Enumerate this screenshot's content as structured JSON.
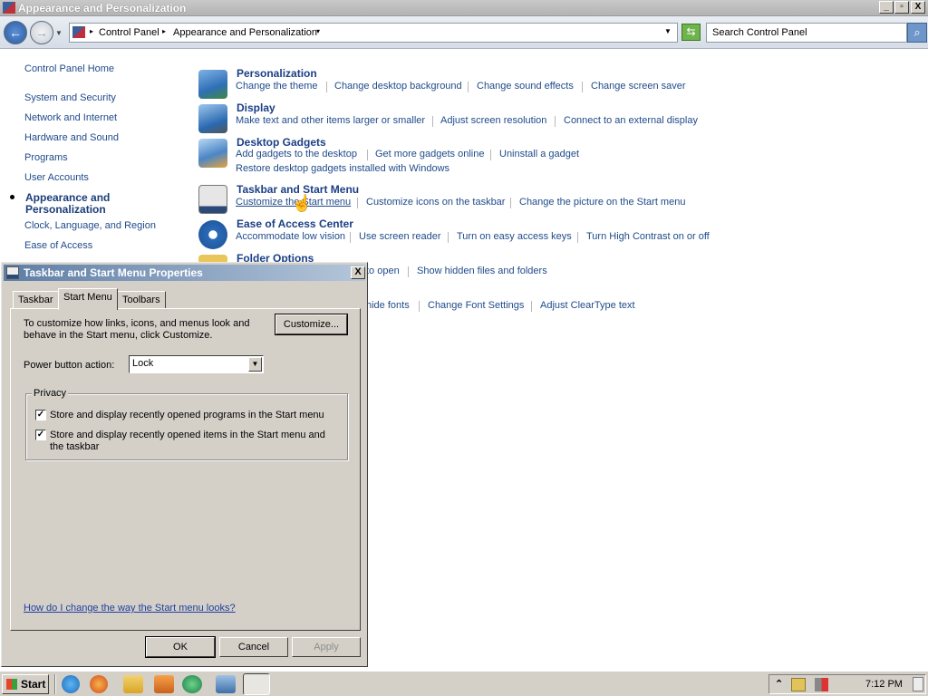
{
  "window": {
    "title": "Appearance and Personalization",
    "controls": {
      "minimize": "_",
      "maximize": "▫",
      "close": "X"
    }
  },
  "addressbar": {
    "crumbs": [
      "Control Panel",
      "Appearance and Personalization"
    ],
    "search_placeholder": "Search Control Panel"
  },
  "sidebar": {
    "home": "Control Panel Home",
    "items": [
      {
        "label": "System and Security"
      },
      {
        "label": "Network and Internet"
      },
      {
        "label": "Hardware and Sound"
      },
      {
        "label": "Programs"
      },
      {
        "label": "User Accounts"
      },
      {
        "label": "Appearance and Personalization",
        "line1": "Appearance and",
        "line2": "Personalization",
        "active": true
      },
      {
        "label": "Clock, Language, and Region"
      },
      {
        "label": "Ease of Access"
      }
    ]
  },
  "categories": {
    "personalization": {
      "title": "Personalization",
      "links": [
        "Change the theme",
        "Change desktop background",
        "Change sound effects",
        "Change screen saver"
      ]
    },
    "display": {
      "title": "Display",
      "links": [
        "Make text and other items larger or smaller",
        "Adjust screen resolution",
        "Connect to an external display"
      ]
    },
    "gadgets": {
      "title": "Desktop Gadgets",
      "links": [
        "Add gadgets to the desktop",
        "Get more gadgets online",
        "Uninstall a gadget",
        "Restore desktop gadgets installed with Windows"
      ]
    },
    "taskbar": {
      "title": "Taskbar and Start Menu",
      "links": [
        "Customize the Start menu",
        "Customize icons on the taskbar",
        "Change the picture on the Start menu"
      ]
    },
    "ease": {
      "title": "Ease of Access Center",
      "links": [
        "Accommodate low vision",
        "Use screen reader",
        "Turn on easy access keys",
        "Turn High Contrast on or off"
      ]
    },
    "folder": {
      "title": "Folder Options",
      "links_visible": [
        "to open",
        "Show hidden files and folders"
      ]
    },
    "fonts": {
      "links_visible": [
        "hide fonts",
        "Change Font Settings",
        "Adjust ClearType text"
      ]
    }
  },
  "dialog": {
    "title": "Taskbar and Start Menu Properties",
    "close": "X",
    "tabs": [
      "Taskbar",
      "Start Menu",
      "Toolbars"
    ],
    "active_tab": "Start Menu",
    "description_line1": "To customize how links, icons, and menus look and",
    "description_line2": "behave in the Start menu, click Customize.",
    "customize_button": "Customize...",
    "power_label": "Power button action:",
    "power_value": "Lock",
    "privacy_legend": "Privacy",
    "checkbox1_label": "Store and display recently opened programs in the Start menu",
    "checkbox2_line1": "Store and display recently opened items in the Start menu and",
    "checkbox2_line2": "the taskbar",
    "checkbox_mark": "✓",
    "help_link": "How do I change the way the Start menu looks?",
    "ok": "OK",
    "cancel": "Cancel",
    "apply": "Apply"
  },
  "taskbar": {
    "start_label": "Start",
    "clock": "7:12 PM",
    "tray_chevron": "⌃"
  },
  "colors": {
    "link": "#1f4a8a",
    "title_link": "#1b3f85",
    "dialog_bg": "#d4d0c8"
  }
}
